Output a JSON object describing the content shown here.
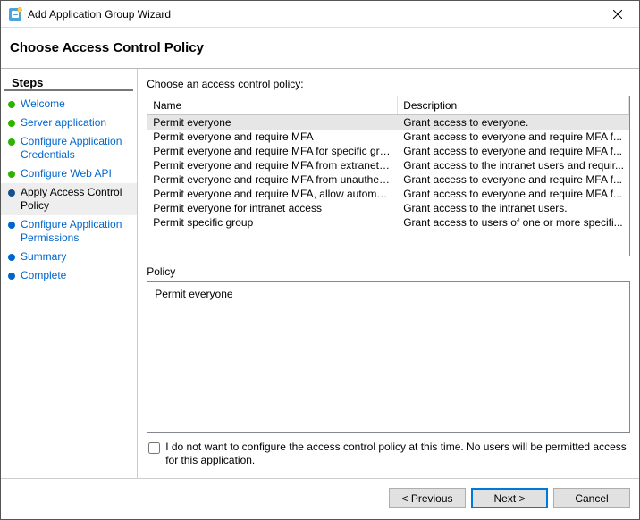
{
  "title": "Add Application Group Wizard",
  "header": "Choose Access Control Policy",
  "steps_header": "Steps",
  "steps": [
    {
      "label": "Welcome",
      "state": "done"
    },
    {
      "label": "Server application",
      "state": "done"
    },
    {
      "label": "Configure Application Credentials",
      "state": "done"
    },
    {
      "label": "Configure Web API",
      "state": "done"
    },
    {
      "label": "Apply Access Control Policy",
      "state": "current"
    },
    {
      "label": "Configure Application Permissions",
      "state": "pending"
    },
    {
      "label": "Summary",
      "state": "pending"
    },
    {
      "label": "Complete",
      "state": "pending"
    }
  ],
  "content": {
    "prompt": "Choose an access control policy:",
    "columns": {
      "name": "Name",
      "description": "Description"
    },
    "policies": [
      {
        "name": "Permit everyone",
        "desc": "Grant access to everyone.",
        "selected": true
      },
      {
        "name": "Permit everyone and require MFA",
        "desc": "Grant access to everyone and require MFA f..."
      },
      {
        "name": "Permit everyone and require MFA for specific group",
        "desc": "Grant access to everyone and require MFA f..."
      },
      {
        "name": "Permit everyone and require MFA from extranet access",
        "desc": "Grant access to the intranet users and requir..."
      },
      {
        "name": "Permit everyone and require MFA from unauthenticated ...",
        "desc": "Grant access to everyone and require MFA f..."
      },
      {
        "name": "Permit everyone and require MFA, allow automatic devi...",
        "desc": "Grant access to everyone and require MFA f..."
      },
      {
        "name": "Permit everyone for intranet access",
        "desc": "Grant access to the intranet users."
      },
      {
        "name": "Permit specific group",
        "desc": "Grant access to users of one or more specifi..."
      }
    ],
    "policy_label": "Policy",
    "policy_detail": "Permit everyone",
    "opt_out_label": "I do not want to configure the access control policy at this time.  No users will be permitted access for this application.",
    "opt_out_checked": false
  },
  "footer": {
    "previous": "< Previous",
    "next": "Next >",
    "cancel": "Cancel"
  }
}
